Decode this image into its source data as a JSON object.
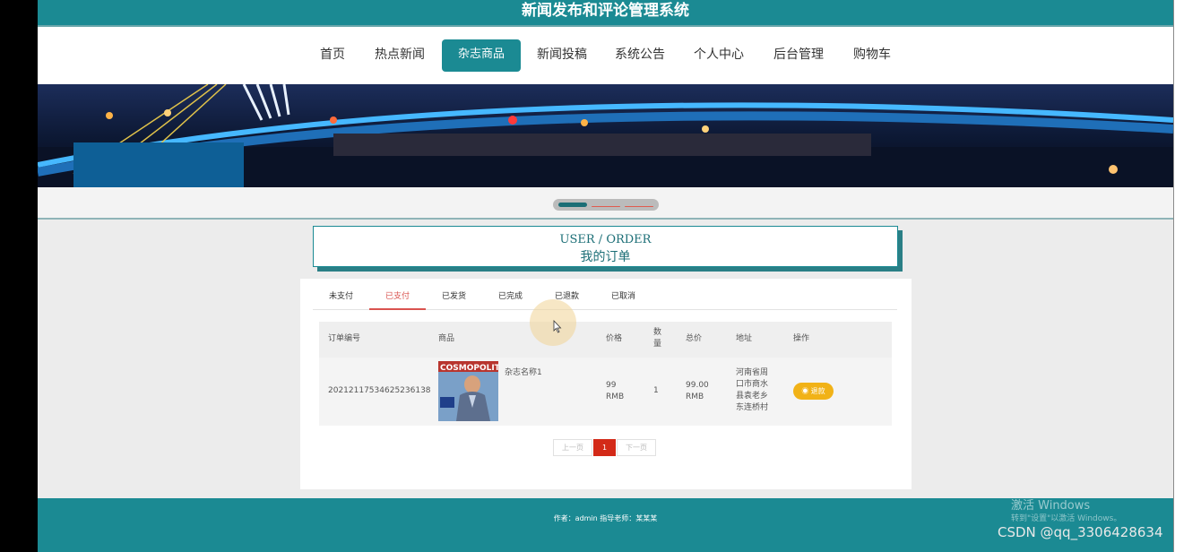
{
  "app": {
    "title": "新闻发布和评论管理系统"
  },
  "nav": {
    "items": [
      {
        "label": "首页"
      },
      {
        "label": "热点新闻"
      },
      {
        "label": "杂志商品"
      },
      {
        "label": "新闻投稿"
      },
      {
        "label": "系统公告"
      },
      {
        "label": "个人中心"
      },
      {
        "label": "后台管理"
      },
      {
        "label": "购物车"
      }
    ],
    "active_index": 2
  },
  "carousel": {
    "active_dot": 0
  },
  "section": {
    "title_en": "USER / ORDER",
    "title_cn": "我的订单"
  },
  "tabs": {
    "items": [
      {
        "label": "未支付"
      },
      {
        "label": "已支付"
      },
      {
        "label": "已发货"
      },
      {
        "label": "已完成"
      },
      {
        "label": "已退款"
      },
      {
        "label": "已取消"
      }
    ],
    "active_index": 1
  },
  "table": {
    "headers": {
      "order_no": "订单编号",
      "product": "商品",
      "price": "价格",
      "qty_1": "数",
      "qty_2": "量",
      "total": "总价",
      "address": "地址",
      "action": "操作"
    },
    "rows": [
      {
        "order_no": "20212117534625236138",
        "product_name": "杂志名称1",
        "cover_title": "COSMOPOLITAN",
        "price_1": "99",
        "price_2": "RMB",
        "qty": "1",
        "total_1": "99.00",
        "total_2": "RMB",
        "address_lines": [
          "河南省周",
          "口市商水",
          "县袁老乡",
          "东连桥村"
        ],
        "action_label": "退款"
      }
    ]
  },
  "pagination": {
    "prev": "上一页",
    "current": "1",
    "next": "下一页"
  },
  "footer": {
    "text": "作者：admin 指导老师：某某某"
  },
  "overlay": {
    "watermark_1": "激活 Windows",
    "watermark_2": "转到\"设置\"以激活 Windows。",
    "csdn": "CSDN @qq_3306428634"
  },
  "colors": {
    "primary": "#1b8a93",
    "active_tab": "#d9534f",
    "refund_button": "#f1b217",
    "pager_current": "#d32a18"
  }
}
